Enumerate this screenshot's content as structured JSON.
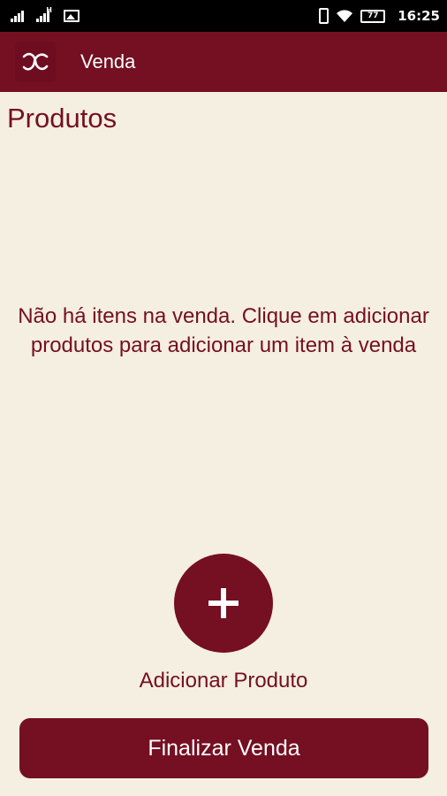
{
  "status_bar": {
    "time": "16:25",
    "battery": "77",
    "icons": [
      "signal-icon",
      "signal-icon",
      "image-icon",
      "vibrate-icon",
      "wifi-icon",
      "battery-icon"
    ]
  },
  "app_bar": {
    "title": "Venda",
    "logo_icon": "app-logo-icon"
  },
  "main": {
    "section_title": "Produtos",
    "empty_message": "Não há itens na venda. Clique em adicionar produtos para adicionar um item à venda",
    "add_button_icon": "plus-icon",
    "add_label": "Adicionar Produto",
    "finish_button_label": "Finalizar Venda"
  },
  "colors": {
    "primary": "#750f22",
    "background": "#f5efe1",
    "status_bar": "#000000"
  }
}
